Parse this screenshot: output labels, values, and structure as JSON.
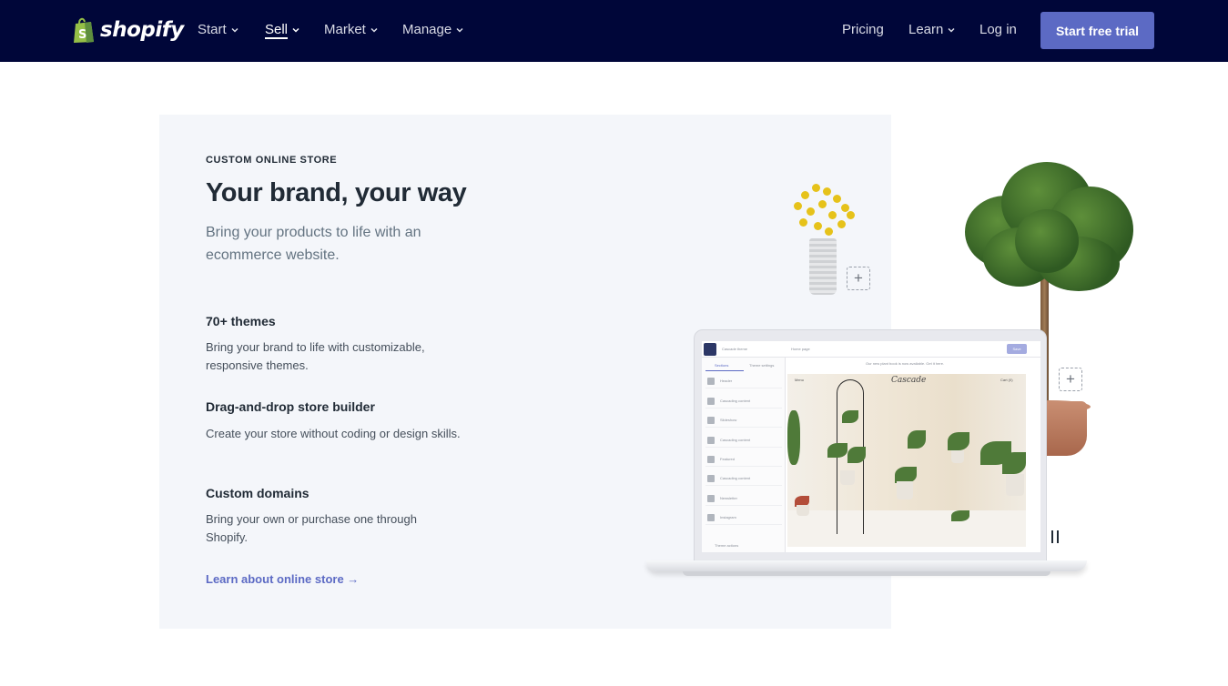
{
  "nav": {
    "logo_text": "shopify",
    "items": [
      {
        "label": "Start",
        "has_dropdown": true,
        "active": false
      },
      {
        "label": "Sell",
        "has_dropdown": true,
        "active": true
      },
      {
        "label": "Market",
        "has_dropdown": true,
        "active": false
      },
      {
        "label": "Manage",
        "has_dropdown": true,
        "active": false
      }
    ],
    "right": [
      {
        "label": "Pricing",
        "has_dropdown": false
      },
      {
        "label": "Learn",
        "has_dropdown": true
      },
      {
        "label": "Log in",
        "has_dropdown": false
      }
    ],
    "cta_label": "Start free trial",
    "background_color": "#000639",
    "cta_color": "#5c6ac4"
  },
  "hero": {
    "eyebrow": "CUSTOM ONLINE STORE",
    "headline": "Your brand, your way",
    "subheadline": "Bring your products to life with an ecommerce website.",
    "features": [
      {
        "title": "70+ themes",
        "description": "Bring your brand to life with customizable, responsive themes."
      },
      {
        "title": "Drag-and-drop store builder",
        "description": "Create your store without coding or design skills."
      },
      {
        "title": "Custom domains",
        "description": "Bring your own or purchase one through Shopify."
      }
    ],
    "learn_link": "Learn about online store →"
  },
  "editor_mockup": {
    "theme_name": "Cascade theme",
    "page_select": "Home page",
    "save_label": "Save",
    "tabs": [
      "Sections",
      "Theme settings"
    ],
    "sections": [
      "Header",
      "Cascading content",
      "Slideshow",
      "Cascading content",
      "Featured",
      "Cascading content",
      "Newsletter",
      "Instagram"
    ],
    "banner_text": "Our new plant book is now available. Get it here.",
    "store_brand": "Cascade",
    "store_menu": "Menu",
    "store_cart": "Cart (0)",
    "theme_actions": "Theme actions"
  },
  "icons": {
    "pause": "pause-icon",
    "add": "plus-icon",
    "logo": "shopify-bag-icon"
  }
}
